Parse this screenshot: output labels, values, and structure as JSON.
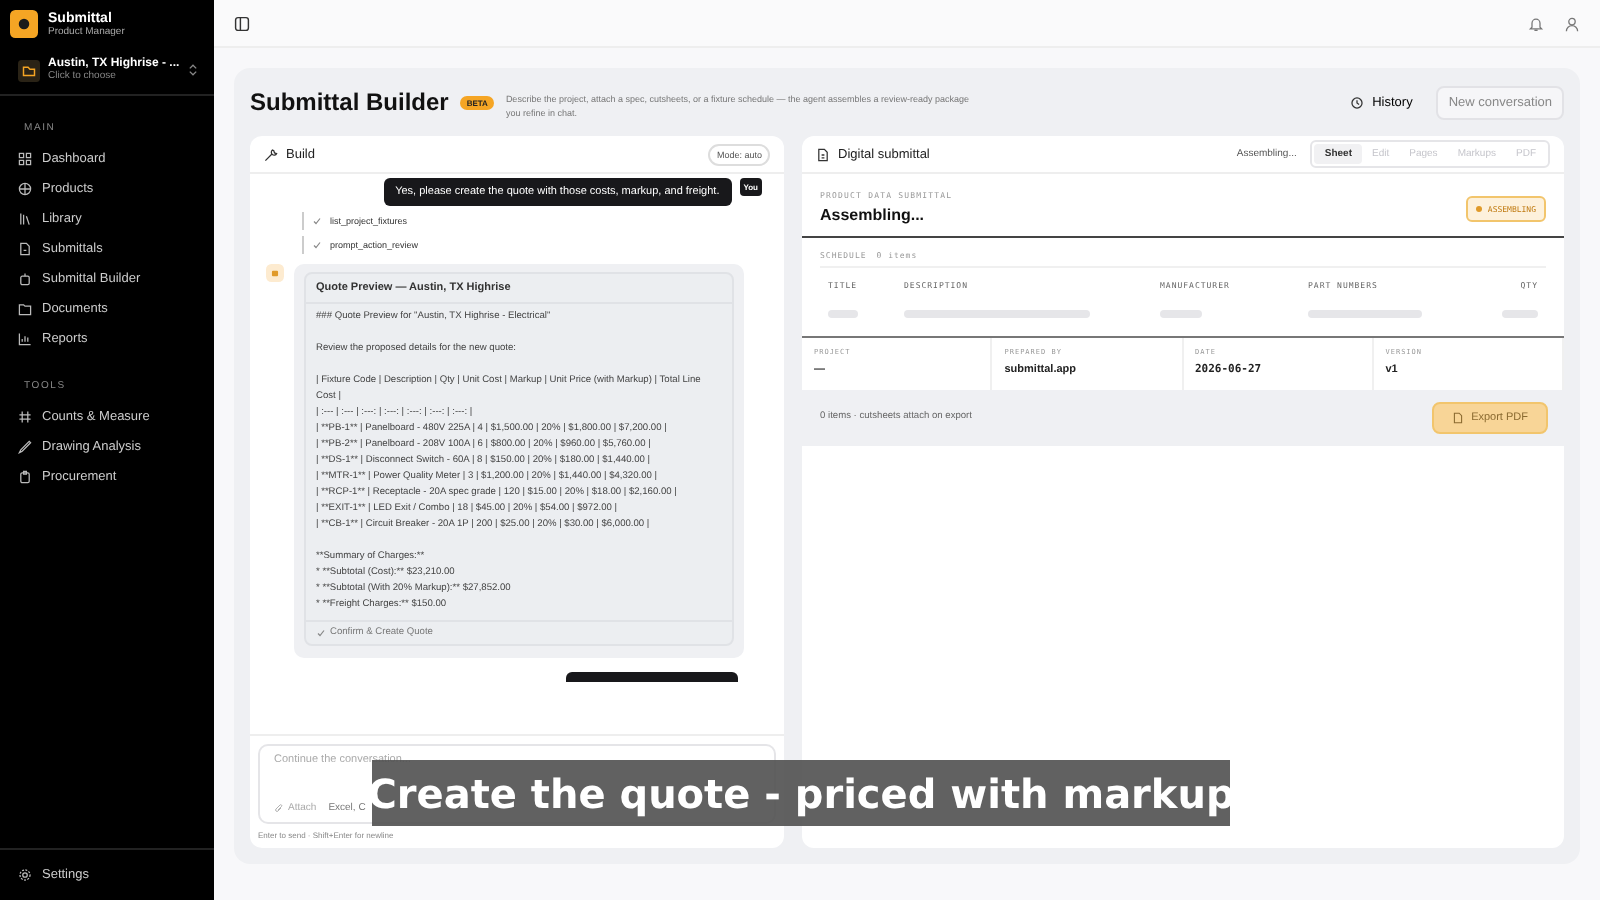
{
  "sidebar": {
    "brand": {
      "name": "Submittal",
      "role": "Product Manager"
    },
    "project": {
      "name": "Austin, TX Highrise - ...",
      "hint": "Click to choose"
    },
    "sections": [
      {
        "title": "MAIN",
        "items": [
          {
            "label": "Dashboard",
            "selected": false
          },
          {
            "label": "Products",
            "selected": false
          },
          {
            "label": "Library",
            "selected": false
          },
          {
            "label": "Submittals",
            "selected": false
          },
          {
            "label": "Submittal Builder",
            "selected": false
          },
          {
            "label": "Documents",
            "selected": false
          },
          {
            "label": "Reports",
            "selected": false
          }
        ]
      },
      {
        "title": "TOOLS",
        "items": [
          {
            "label": "Counts & Measure",
            "selected": false
          },
          {
            "label": "Drawing Analysis",
            "selected": false
          },
          {
            "label": "Procurement",
            "selected": false
          }
        ]
      }
    ],
    "settings": "Settings"
  },
  "page": {
    "title": "Submittal Builder",
    "badge": "BETA",
    "description": "Describe the project, attach a spec, cutsheets, or a fixture schedule — the agent assembles a review-ready package you refine in chat.",
    "history": "History",
    "new_conversation": "New conversation"
  },
  "build": {
    "title": "Build",
    "mode": "Mode: auto",
    "messages": [
      {
        "kind": "user",
        "text": "Yes, please create the quote with those costs, markup, and freight.",
        "avatar": "You"
      },
      {
        "kind": "tool",
        "text": "list_project_fixtures"
      },
      {
        "kind": "tool",
        "text": "prompt_action_review"
      },
      {
        "kind": "card",
        "title": "Quote Preview — Austin, TX Highrise",
        "blocks": [
          [
            "### Quote Preview for \"Austin, TX Highrise - Electrical\""
          ],
          [
            "Review the proposed details for the new quote:"
          ],
          [
            "| Fixture Code | Description | Qty | Unit Cost | Markup | Unit Price (with Markup) | Total Line Cost |",
            "| :--- | :--- | :---: | :---: | :---: | :---: | :---: |",
            "| **PB-1** | Panelboard - 480V 225A | 4 | $1,500.00 | 20% | $1,800.00 | $7,200.00 |",
            "| **PB-2** | Panelboard - 208V 100A | 6 | $800.00 | 20% | $960.00 | $5,760.00 |",
            "| **DS-1** | Disconnect Switch - 60A | 8 | $150.00 | 20% | $180.00 | $1,440.00 |",
            "| **MTR-1** | Power Quality Meter | 3 | $1,200.00 | 20% | $1,440.00 | $4,320.00 |",
            "| **RCP-1** | Receptacle - 20A spec grade | 120 | $15.00 | 20% | $18.00 | $2,160.00 |",
            "| **EXIT-1** | LED Exit / Combo | 18 | $45.00 | 20% | $54.00 | $972.00 |",
            "| **CB-1** | Circuit Breaker - 20A 1P | 200 | $25.00 | 20% | $30.00 | $6,000.00 |"
          ],
          [
            "**Summary of Charges:**",
            "* **Subtotal (Cost):** $23,210.00",
            "* **Subtotal (With 20% Markup):** $27,852.00",
            "* **Freight Charges:** $150.00"
          ]
        ],
        "action": "Confirm & Create Quote"
      },
      {
        "kind": "user_cut"
      }
    ],
    "input": {
      "placeholder": "Continue the conversation...",
      "attach": "Attach",
      "formats": "Excel, C",
      "hint": "Enter to send · Shift+Enter for newline"
    }
  },
  "submittal": {
    "title": "Digital submittal",
    "status": "Assembling...",
    "tabs": [
      {
        "label": "Sheet",
        "selected": true,
        "disabled": false
      },
      {
        "label": "Edit",
        "selected": false,
        "disabled": true
      },
      {
        "label": "Pages",
        "selected": false,
        "disabled": true
      },
      {
        "label": "Markups",
        "selected": false,
        "disabled": true
      },
      {
        "label": "PDF",
        "selected": false,
        "disabled": true
      }
    ],
    "kicker": "PRODUCT DATA SUBMITTAL",
    "heading": "Assembling...",
    "badge": "ASSEMBLING",
    "schedule": {
      "label": "SCHEDULE",
      "count": "0 items",
      "columns": [
        "TITLE",
        "DESCRIPTION",
        "MANUFACTURER",
        "PART NUMBERS",
        "QTY"
      ]
    },
    "meta": [
      {
        "label": "PROJECT",
        "value": "—"
      },
      {
        "label": "PREPARED BY",
        "value": "submittal.app"
      },
      {
        "label": "DATE",
        "value": "2026-06-27"
      },
      {
        "label": "VERSION",
        "value": "v1"
      }
    ],
    "footer": "0 items · cutsheets attach on export",
    "export": "Export PDF"
  },
  "caption": "Create the quote - priced with markup"
}
